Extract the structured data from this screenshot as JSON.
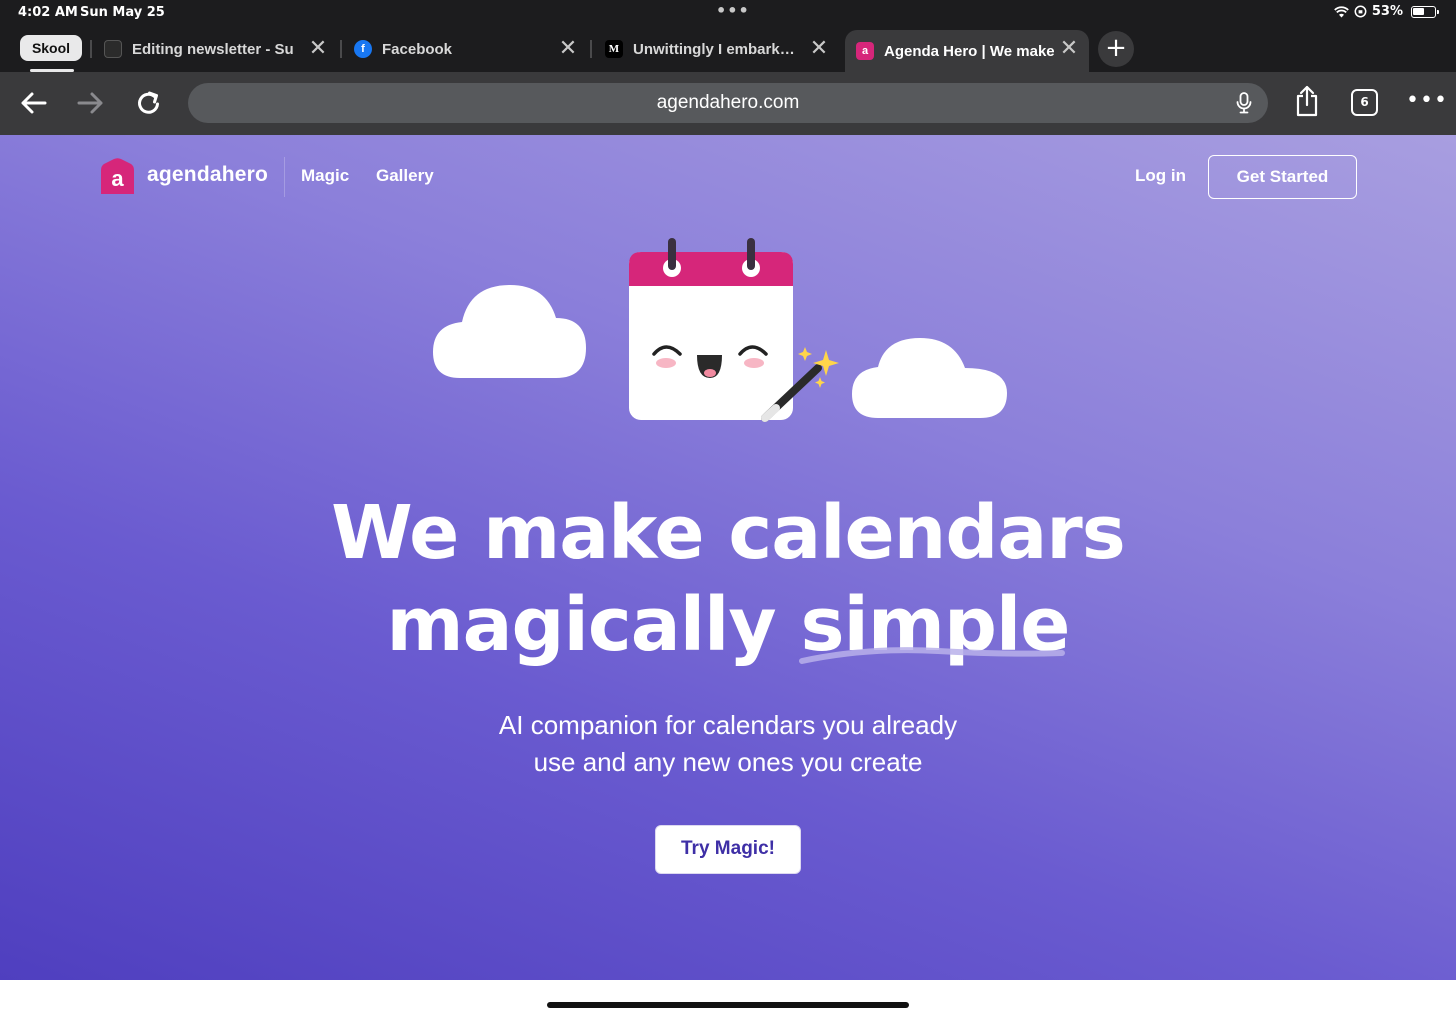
{
  "status_bar": {
    "time": "4:02 AM",
    "date": "Sun May 25",
    "battery": "53%"
  },
  "tabs": [
    {
      "pill_label": "Skool"
    },
    {
      "title": "Editing newsletter - Su",
      "favicon": "substack-icon"
    },
    {
      "title": "Facebook",
      "favicon": "facebook-icon",
      "favicon_color": "#1877f2"
    },
    {
      "title": "Unwittingly I embark…",
      "favicon": "medium-icon",
      "favicon_text": "M"
    },
    {
      "title": "Agenda Hero | We make",
      "favicon": "agendahero-icon",
      "favicon_text": "a",
      "favicon_color": "#d6267a",
      "active": true
    }
  ],
  "tab_count": "6",
  "address_bar": {
    "url": "agendahero.com"
  },
  "site": {
    "brand": "agendahero",
    "logo_letter": "a",
    "brand_color": "#d6267a",
    "nav": {
      "magic": "Magic",
      "gallery": "Gallery"
    },
    "login": "Log in",
    "get_started": "Get Started",
    "headline_line1": "We make calendars",
    "headline_line2_a": "magically",
    "headline_line2_b": "simple",
    "subtitle_line1": "AI companion for calendars you already",
    "subtitle_line2": "use and any new ones you create",
    "cta": "Try Magic!",
    "accent_color": "#3e2fa6"
  }
}
